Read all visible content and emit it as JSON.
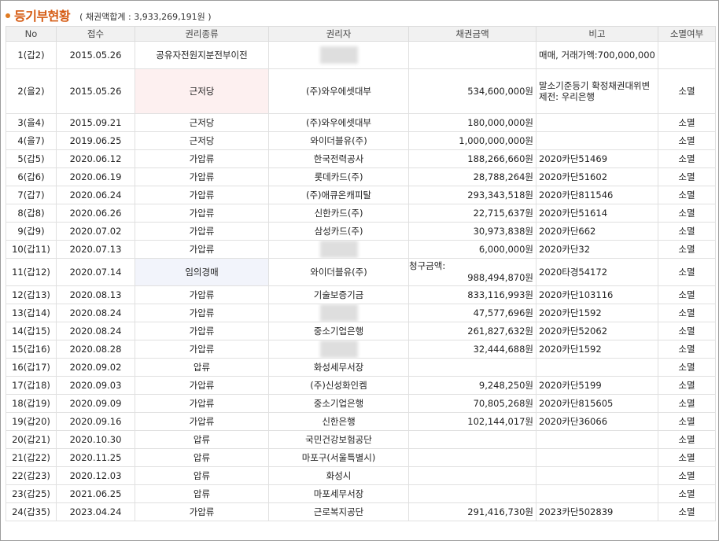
{
  "header": {
    "title": "등기부현황",
    "summary": "( 채권액합계 : 3,933,269,191원 )"
  },
  "columns": [
    "No",
    "접수",
    "권리종류",
    "권리자",
    "채권금액",
    "비고",
    "소멸여부"
  ],
  "rows": [
    {
      "no": "1(갑2)",
      "date": "2015.05.26",
      "type": "공유자전원지분전부이전",
      "holder": "",
      "amount": "",
      "note": "매매, 거래가액:700,000,000",
      "status": "",
      "holder_blur": true
    },
    {
      "no": "2(을2)",
      "date": "2015.05.26",
      "type": "근저당",
      "holder": "(주)와우에셋대부",
      "amount": "534,600,000원",
      "note": "말소기준등기 확정채권대위변제전: 우리은행",
      "status": "소멸",
      "type_hl": "pink"
    },
    {
      "no": "3(을4)",
      "date": "2015.09.21",
      "type": "근저당",
      "holder": "(주)와우에셋대부",
      "amount": "180,000,000원",
      "note": "",
      "status": "소멸"
    },
    {
      "no": "4(을7)",
      "date": "2019.06.25",
      "type": "근저당",
      "holder": "와이더블유(주)",
      "amount": "1,000,000,000원",
      "note": "",
      "status": "소멸"
    },
    {
      "no": "5(갑5)",
      "date": "2020.06.12",
      "type": "가압류",
      "holder": "한국전력공사",
      "amount": "188,266,660원",
      "note": "2020카단51469",
      "status": "소멸"
    },
    {
      "no": "6(갑6)",
      "date": "2020.06.19",
      "type": "가압류",
      "holder": "롯데카드(주)",
      "amount": "28,788,264원",
      "note": "2020카단51602",
      "status": "소멸"
    },
    {
      "no": "7(갑7)",
      "date": "2020.06.24",
      "type": "가압류",
      "holder": "(주)애큐온캐피탈",
      "amount": "293,343,518원",
      "note": "2020카단811546",
      "status": "소멸"
    },
    {
      "no": "8(갑8)",
      "date": "2020.06.26",
      "type": "가압류",
      "holder": "신한카드(주)",
      "amount": "22,715,637원",
      "note": "2020카단51614",
      "status": "소멸"
    },
    {
      "no": "9(갑9)",
      "date": "2020.07.02",
      "type": "가압류",
      "holder": "삼성카드(주)",
      "amount": "30,973,838원",
      "note": "2020카단662",
      "status": "소멸"
    },
    {
      "no": "10(갑11)",
      "date": "2020.07.13",
      "type": "가압류",
      "holder": "",
      "amount": "6,000,000원",
      "note": "2020카단32",
      "status": "소멸",
      "holder_blur": true
    },
    {
      "no": "11(갑12)",
      "date": "2020.07.14",
      "type": "임의경매",
      "holder": "와이더블유(주)",
      "amount": "988,494,870원",
      "amount_label": "청구금액:",
      "note": "2020타경54172",
      "status": "소멸",
      "type_hl": "blue"
    },
    {
      "no": "12(갑13)",
      "date": "2020.08.13",
      "type": "가압류",
      "holder": "기술보증기금",
      "amount": "833,116,993원",
      "note": "2020카단103116",
      "status": "소멸"
    },
    {
      "no": "13(갑14)",
      "date": "2020.08.24",
      "type": "가압류",
      "holder": "",
      "amount": "47,577,696원",
      "note": "2020카단1592",
      "status": "소멸",
      "holder_blur": true
    },
    {
      "no": "14(갑15)",
      "date": "2020.08.24",
      "type": "가압류",
      "holder": "중소기업은행",
      "amount": "261,827,632원",
      "note": "2020카단52062",
      "status": "소멸"
    },
    {
      "no": "15(갑16)",
      "date": "2020.08.28",
      "type": "가압류",
      "holder": "",
      "amount": "32,444,688원",
      "note": "2020카단1592",
      "status": "소멸",
      "holder_blur": true
    },
    {
      "no": "16(갑17)",
      "date": "2020.09.02",
      "type": "압류",
      "holder": "화성세무서장",
      "amount": "",
      "note": "",
      "status": "소멸"
    },
    {
      "no": "17(갑18)",
      "date": "2020.09.03",
      "type": "가압류",
      "holder": "(주)신성화인켐",
      "amount": "9,248,250원",
      "note": "2020카단5199",
      "status": "소멸"
    },
    {
      "no": "18(갑19)",
      "date": "2020.09.09",
      "type": "가압류",
      "holder": "중소기업은행",
      "amount": "70,805,268원",
      "note": "2020카단815605",
      "status": "소멸"
    },
    {
      "no": "19(갑20)",
      "date": "2020.09.16",
      "type": "가압류",
      "holder": "신한은행",
      "amount": "102,144,017원",
      "note": "2020카단36066",
      "status": "소멸"
    },
    {
      "no": "20(갑21)",
      "date": "2020.10.30",
      "type": "압류",
      "holder": "국민건강보험공단",
      "amount": "",
      "note": "",
      "status": "소멸"
    },
    {
      "no": "21(갑22)",
      "date": "2020.11.25",
      "type": "압류",
      "holder": "마포구(서울특별시)",
      "amount": "",
      "note": "",
      "status": "소멸"
    },
    {
      "no": "22(갑23)",
      "date": "2020.12.03",
      "type": "압류",
      "holder": "화성시",
      "amount": "",
      "note": "",
      "status": "소멸"
    },
    {
      "no": "23(갑25)",
      "date": "2021.06.25",
      "type": "압류",
      "holder": "마포세무서장",
      "amount": "",
      "note": "",
      "status": "소멸"
    },
    {
      "no": "24(갑35)",
      "date": "2023.04.24",
      "type": "가압류",
      "holder": "근로복지공단",
      "amount": "291,416,730원",
      "note": "2023카단502839",
      "status": "소멸"
    }
  ]
}
